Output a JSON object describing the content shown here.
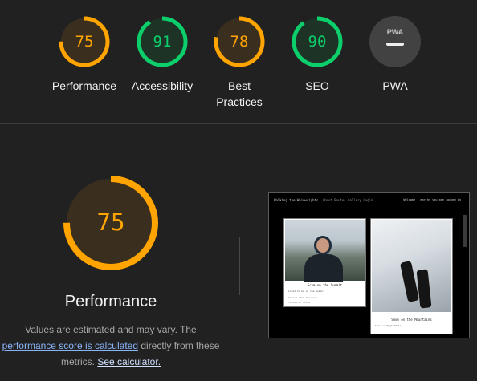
{
  "gauges": [
    {
      "score": "75",
      "label": "Performance",
      "value": 0.75,
      "color": "#ffa400",
      "fill": "#3a2f1e"
    },
    {
      "score": "91",
      "label": "Accessibility",
      "value": 0.91,
      "color": "#0cce6b",
      "fill": "#1d3325"
    },
    {
      "score": "78",
      "label": "Best Practices",
      "value": 0.78,
      "color": "#ffa400",
      "fill": "#3a2f1e"
    },
    {
      "score": "90",
      "label": "SEO",
      "value": 0.9,
      "color": "#0cce6b",
      "fill": "#1d3325"
    },
    {
      "score": "PWA",
      "label": "PWA",
      "icon": "pwa-dash-icon",
      "color": "#9e9e9e",
      "fill": "#424242"
    }
  ],
  "performance": {
    "score": "75",
    "value": 0.75,
    "title": "Performance",
    "desc_prefix": "Values are estimated and may vary. The ",
    "link_text": "performance score is calculated",
    "desc_middle": " directly from these metrics. ",
    "calc_link": "See calculator."
  },
  "thumbnail": {
    "site_title": "Walking the Wainwrights",
    "nav_links": "About  Routes  Gallery  Login",
    "welcome": "Welcome  -  marths you are logged in",
    "card_a": {
      "title": "Scum on the Summit",
      "sub1": "Loved to be on the summit",
      "sub2": "Walked 10mi 2hr/time",
      "sub3": "Fantastic route"
    },
    "card_b": {
      "title": "Snow on the Mountains",
      "sub1": "Snow on High Stile"
    }
  },
  "colors": {
    "orange": "#ffa400",
    "green": "#0cce6b",
    "background": "#212121"
  }
}
